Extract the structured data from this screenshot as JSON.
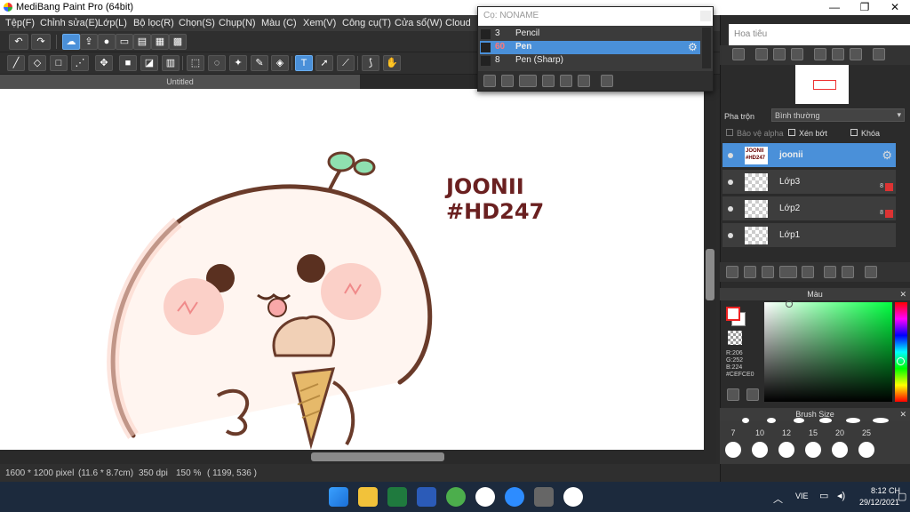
{
  "window": {
    "title": "MediBang Paint Pro (64bit)",
    "min": "—",
    "max": "❐",
    "close": "✕"
  },
  "menu": [
    "Tệp(F)",
    "Chỉnh sửa(E)",
    "Lớp(L)",
    "Bộ lọc(R)",
    "Chọn(S)",
    "Chụp(N)",
    "Màu (C)",
    "Xem(V)",
    "Công cụ(T)",
    "Cửa sổ(W)",
    "Cloud"
  ],
  "toolbar1": [
    "undo-icon",
    "redo-icon",
    "cloud-icon",
    "export-icon",
    "bubble-icon",
    "speech-icon",
    "page-icon",
    "panel-icon",
    "grid-icon"
  ],
  "toolbar2": [
    "brush-icon",
    "eraser-icon",
    "rect-icon",
    "dotline-icon",
    "move-icon",
    "fill-rect-icon",
    "bucket-icon",
    "gradient-icon",
    "select-rect-icon",
    "lasso-icon",
    "magic-wand-icon",
    "select-pen-icon",
    "select-eraser-icon",
    "text-icon",
    "operation-icon",
    "divide-icon",
    "eyedropper-icon",
    "hand-icon"
  ],
  "doc_tab": "Untitled",
  "canvas": {
    "line1": "JOONII",
    "line2": "#HD247"
  },
  "status": {
    "size": "1600 * 1200 pixel",
    "cm": "(11.6 * 8.7cm)",
    "dpi": "350 dpi",
    "zoom": "150 %",
    "coords": "( 1199, 536 )"
  },
  "brush_panel": {
    "header": "Cọ: NONAME",
    "rows": [
      {
        "num": "3",
        "name": "Pencil"
      },
      {
        "num": "60",
        "name": "Pen"
      },
      {
        "num": "8",
        "name": "Pen (Sharp)"
      }
    ]
  },
  "navigator": {
    "title": "Hoa tiêu"
  },
  "layer_props": {
    "blend_label": "Pha trộn",
    "blend_value": "Bình thường",
    "protect_alpha": "Bảo vệ alpha",
    "clipping": "Xén bớt",
    "lock": "Khóa"
  },
  "layers": [
    {
      "name": "joonii",
      "selected": true
    },
    {
      "name": "Lớp3",
      "badge": "8"
    },
    {
      "name": "Lớp2",
      "badge": "8"
    },
    {
      "name": "Lớp1"
    }
  ],
  "color_panel": {
    "title": "Màu",
    "r": "R:206",
    "g": "G:252",
    "b": "B:224",
    "hex": "#CEFCE0",
    "primary": "#ff0000",
    "secondary": "#ffffff"
  },
  "brush_size": {
    "title": "Brush Size",
    "sizes": [
      "7",
      "10",
      "12",
      "15",
      "20",
      "25"
    ]
  },
  "taskbar": {
    "lang": "VIE",
    "time": "8:12 CH",
    "date": "29/12/2021"
  }
}
